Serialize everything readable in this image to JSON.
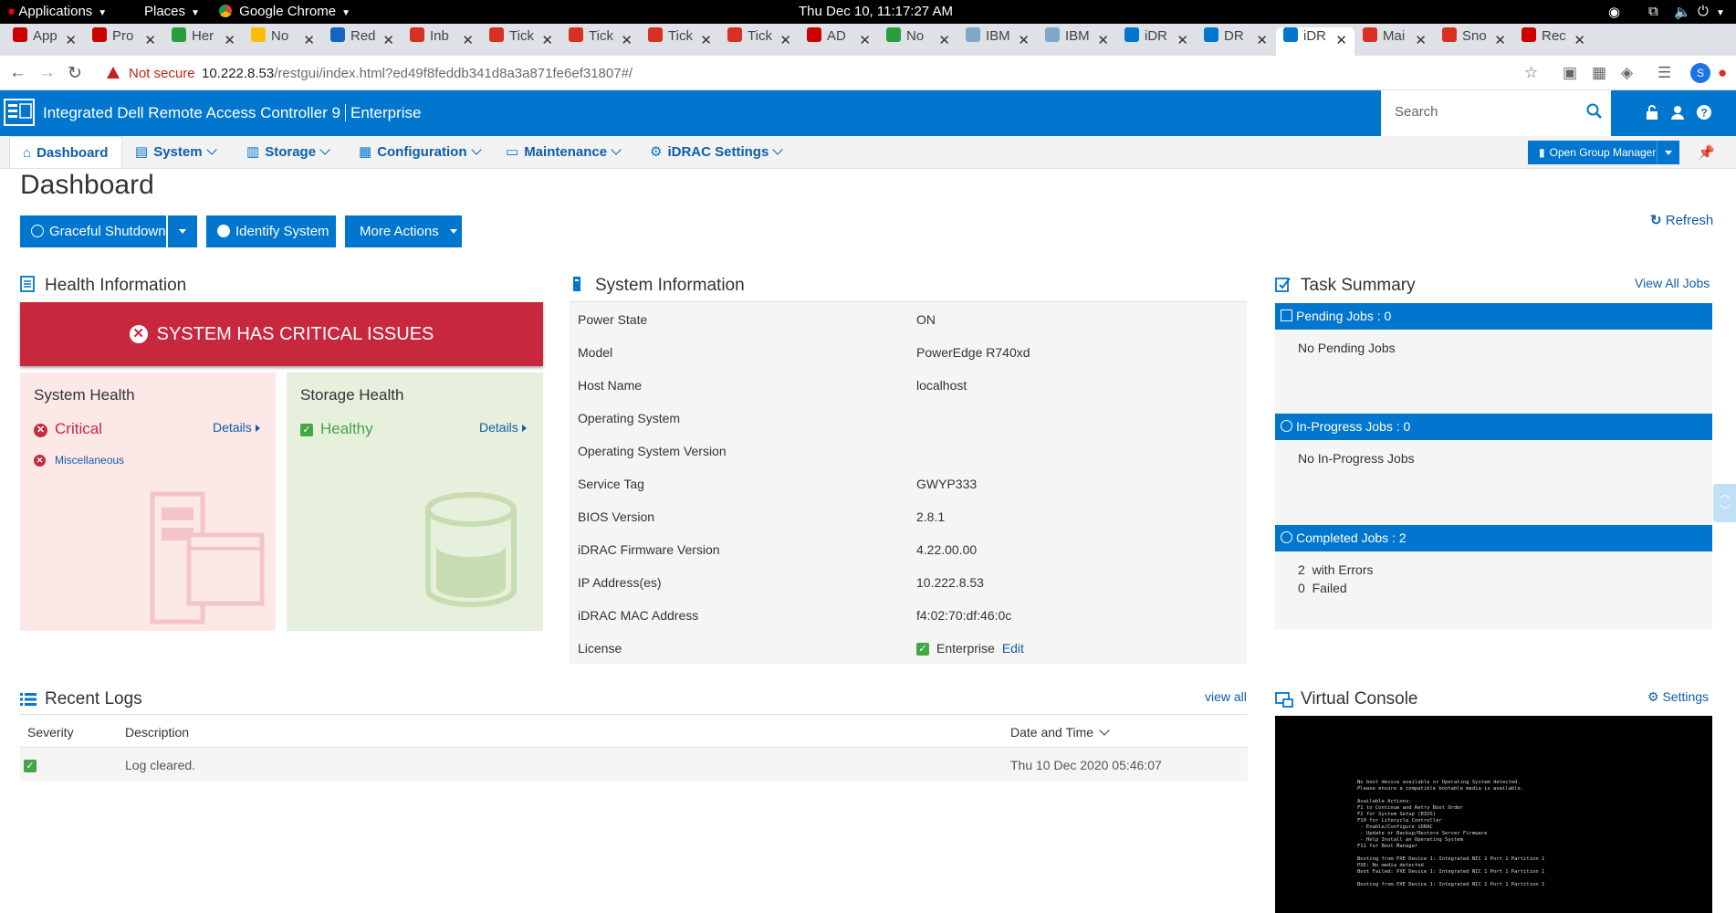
{
  "gnome": {
    "applications": "Applications",
    "places": "Places",
    "browser": "Google Chrome",
    "clock": "Thu Dec 10, 11:17:27 AM"
  },
  "tabs": [
    {
      "label": "App",
      "color": "#c00"
    },
    {
      "label": "Pro",
      "color": "#c00"
    },
    {
      "label": "Her",
      "color": "#2a9d3d"
    },
    {
      "label": "No",
      "color": "#fbbc04"
    },
    {
      "label": "Red",
      "color": "#1565c0"
    },
    {
      "label": "Inb",
      "color": "#d93025"
    },
    {
      "label": "Tick",
      "color": "#d93025"
    },
    {
      "label": "Tick",
      "color": "#d93025"
    },
    {
      "label": "Tick",
      "color": "#d93025"
    },
    {
      "label": "Tick",
      "color": "#d93025"
    },
    {
      "label": "AD",
      "color": "#c00"
    },
    {
      "label": "No",
      "color": "#2a9d3d"
    },
    {
      "label": "IBM",
      "color": "#7fa7c7"
    },
    {
      "label": "IBM",
      "color": "#7fa7c7"
    },
    {
      "label": "iDR",
      "color": "#0076ce"
    },
    {
      "label": "DR",
      "color": "#0076ce"
    },
    {
      "label": "iDR",
      "color": "#0076ce"
    },
    {
      "label": "Mai",
      "color": "#d93025"
    },
    {
      "label": "Sno",
      "color": "#d93025"
    },
    {
      "label": "Rec",
      "color": "#c00"
    }
  ],
  "address": {
    "not_secure": "Not secure",
    "host": "10.222.8.53",
    "path": "/restgui/index.html?ed49f8feddb341d8a3a871fe6ef31807#/"
  },
  "profile_initial": "S",
  "header": {
    "title": "Integrated Dell Remote Access Controller 9",
    "edition": "Enterprise",
    "search_placeholder": "Search"
  },
  "nav": {
    "dashboard": "Dashboard",
    "system": "System",
    "storage": "Storage",
    "configuration": "Configuration",
    "maintenance": "Maintenance",
    "idrac_settings": "iDRAC Settings",
    "open_group_manager": "Open Group Manager"
  },
  "page": {
    "title": "Dashboard",
    "graceful_shutdown": "Graceful Shutdown",
    "identify_system": "Identify System",
    "more_actions": "More Actions",
    "refresh": "Refresh"
  },
  "health": {
    "title": "Health Information",
    "banner": "SYSTEM HAS CRITICAL ISSUES",
    "system_health_title": "System Health",
    "system_status": "Critical",
    "system_detail": "Miscellaneous",
    "storage_health_title": "Storage Health",
    "storage_status": "Healthy",
    "details": "Details"
  },
  "system_info": {
    "title": "System Information",
    "rows": [
      {
        "key": "Power State",
        "value": "ON"
      },
      {
        "key": "Model",
        "value": "PowerEdge R740xd"
      },
      {
        "key": "Host Name",
        "value": "localhost"
      },
      {
        "key": "Operating System",
        "value": ""
      },
      {
        "key": "Operating System Version",
        "value": ""
      },
      {
        "key": "Service Tag",
        "value": "GWYP333"
      },
      {
        "key": "BIOS Version",
        "value": "2.8.1"
      },
      {
        "key": "iDRAC Firmware Version",
        "value": "4.22.00.00"
      },
      {
        "key": "IP Address(es)",
        "value": "10.222.8.53"
      },
      {
        "key": "iDRAC MAC Address",
        "value": "f4:02:70:df:46:0c"
      }
    ],
    "license_key": "License",
    "license_value": "Enterprise",
    "license_edit": "Edit"
  },
  "tasks": {
    "title": "Task Summary",
    "view_all": "View All Jobs",
    "pending_head": "Pending Jobs : 0",
    "pending_body": "No Pending Jobs",
    "inprogress_head": "In-Progress Jobs : 0",
    "inprogress_body": "No In-Progress Jobs",
    "completed_head": "Completed Jobs : 2",
    "completed_errors_count": "2",
    "completed_errors_label": "with Errors",
    "completed_failed_count": "0",
    "completed_failed_label": "Failed"
  },
  "logs": {
    "title": "Recent Logs",
    "view_all": "view all",
    "col_severity": "Severity",
    "col_description": "Description",
    "col_datetime": "Date and Time",
    "rows": [
      {
        "description": "Log cleared.",
        "datetime": "Thu 10 Dec 2020 05:46:07"
      }
    ]
  },
  "console": {
    "title": "Virtual Console",
    "settings": "Settings",
    "screen_text": "No boot device available or Operating System detected.\nPlease ensure a compatible bootable media is available.\n\nAvailable Actions:\nF1 to Continue and Retry Boot Order\nF2 for System Setup (BIOS)\nF10 for Lifecycle Controller\n - Enable/Configure iDRAC\n - Update or Backup/Restore Server Firmware\n - Help Install an Operating System\nF11 for Boot Manager\n\nBooting from PXE Device 1: Integrated NIC 1 Port 1 Partition 1\nPXE: No media detected\nBoot Failed: PXE Device 1: Integrated NIC 1 Port 1 Partition 1\n\nBooting from PXE Device 1: Integrated NIC 1 Port 1 Partition 1"
  },
  "colors": {
    "brand": "#0076ce",
    "critical": "#c7283e",
    "healthy": "#44a647"
  }
}
